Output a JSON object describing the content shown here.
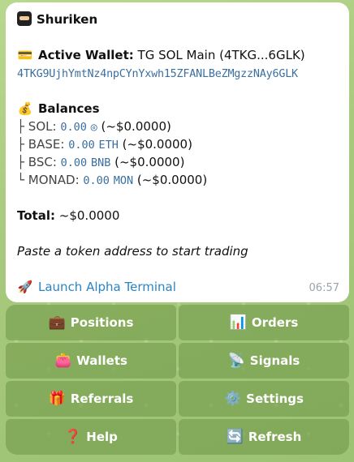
{
  "message": {
    "title": "Shuriken",
    "wallet": {
      "label": "Active Wallet:",
      "name": "TG SOL Main (4TKG...6GLK)",
      "address": "4TKG9UjhYmtNz4npCYnYxwh15ZFANLBeZMgzzNAy6GLK"
    },
    "balances": {
      "label": "Balances",
      "rows": [
        {
          "prefix": "├ SOL:",
          "amount": "0.00",
          "unit": "◎",
          "usd": "(~$0.0000)"
        },
        {
          "prefix": "├ BASE:",
          "amount": "0.00",
          "unit": "ETH",
          "usd": "(~$0.0000)"
        },
        {
          "prefix": "├ BSC:",
          "amount": "0.00",
          "unit": "BNB",
          "usd": "(~$0.0000)"
        },
        {
          "prefix": "└ MONAD:",
          "amount": "0.00",
          "unit": "MON",
          "usd": "(~$0.0000)"
        }
      ]
    },
    "total": {
      "label": "Total:",
      "value": "~$0.0000"
    },
    "hint": "Paste a token address to start trading",
    "terminal_link": "Launch Alpha Terminal",
    "time": "06:57"
  },
  "icons": {
    "title": "ninja-icon",
    "wallet": "credit-card-icon",
    "balances": "money-bag-icon",
    "terminal": "rocket-icon"
  },
  "buttons": [
    {
      "id": "positions",
      "icon": "💼",
      "label": "Positions"
    },
    {
      "id": "orders",
      "icon": "📊",
      "label": "Orders"
    },
    {
      "id": "wallets",
      "icon": "👛",
      "label": "Wallets"
    },
    {
      "id": "signals",
      "icon": "📡",
      "label": "Signals"
    },
    {
      "id": "referrals",
      "icon": "🎁",
      "label": "Referrals"
    },
    {
      "id": "settings",
      "icon": "⚙️",
      "label": "Settings"
    },
    {
      "id": "help",
      "icon": "❓",
      "label": "Help"
    },
    {
      "id": "refresh",
      "icon": "🔄",
      "label": "Refresh"
    }
  ]
}
